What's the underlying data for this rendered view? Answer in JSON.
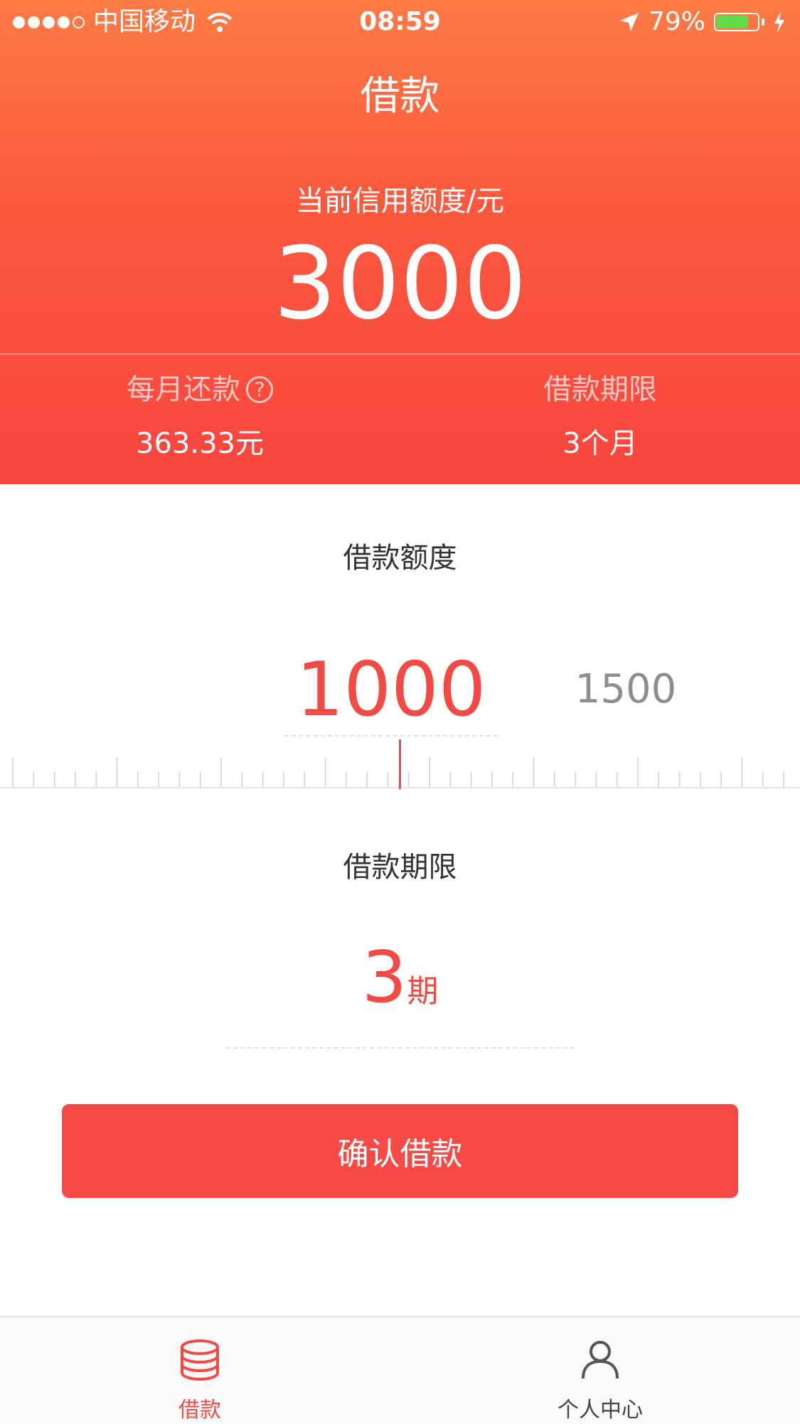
{
  "status_bar": {
    "carrier": "中国移动",
    "time": "08:59",
    "battery": "79%",
    "battery_level": 0.79
  },
  "nav": {
    "title": "借款"
  },
  "credit": {
    "label": "当前信用额度/元",
    "value": "3000"
  },
  "summary": {
    "monthly_label": "每月还款",
    "monthly_help": "?",
    "monthly_value": "363.33元",
    "term_label": "借款期限",
    "term_value": "3个月"
  },
  "amount": {
    "title": "借款额度",
    "current": "1000",
    "next": "1500"
  },
  "period": {
    "title": "借款期限",
    "value": "3",
    "unit": "期"
  },
  "confirm_label": "确认借款",
  "tabs": [
    {
      "label": "借款",
      "icon": "coin-stack-icon",
      "active": true
    },
    {
      "label": "个人中心",
      "icon": "person-icon",
      "active": false
    }
  ],
  "colors": {
    "accent": "#f24a44",
    "header_top": "#fd7b45",
    "header_bottom": "#f9453f",
    "inactive": "#8e8e8e"
  }
}
